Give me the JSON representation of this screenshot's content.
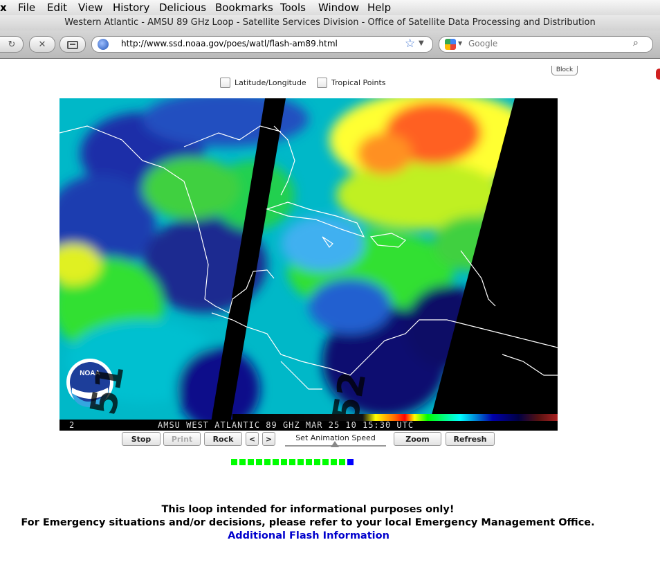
{
  "menubar": {
    "apple": "x",
    "items": [
      "File",
      "Edit",
      "View",
      "History",
      "Delicious",
      "Bookmarks",
      "Tools",
      "Window",
      "Help"
    ]
  },
  "window": {
    "title": "Western Atlantic - AMSU 89 GHz Loop - Satellite Services Division - Office of Satellite Data Processing and Distribution"
  },
  "toolbar": {
    "url": "http://www.ssd.noaa.gov/poes/watl/flash-am89.html",
    "search_placeholder": "Google"
  },
  "page": {
    "block_label": "Block",
    "overlays": [
      {
        "label": "Latitude/Longitude",
        "checked": false
      },
      {
        "label": "Tropical Points",
        "checked": false
      }
    ],
    "map": {
      "noaa_logo_text": "NOAA",
      "frame_number": "2",
      "caption": "AMSU WEST ATLANTIC  89 GHZ MAR 25 10 15:30 UTC",
      "swath_labels": [
        "51",
        "52"
      ]
    },
    "controls": {
      "stop": "Stop",
      "print": "Print",
      "rock": "Rock",
      "prev": "<",
      "next": ">",
      "speed_label": "Set Animation Speed",
      "speed_fraction": 0.49,
      "zoom": "Zoom",
      "refresh": "Refresh"
    },
    "frames": {
      "total": 15,
      "current": 15
    },
    "notice_line1": "This loop intended for informational purposes only!",
    "notice_line2": "For Emergency situations and/or decisions, please refer to your local Emergency Management Office.",
    "flash_link": "Additional Flash Information"
  },
  "colors": {
    "frame_loaded": "#00ff00",
    "frame_current": "#0000ff",
    "link": "#0000cc"
  }
}
